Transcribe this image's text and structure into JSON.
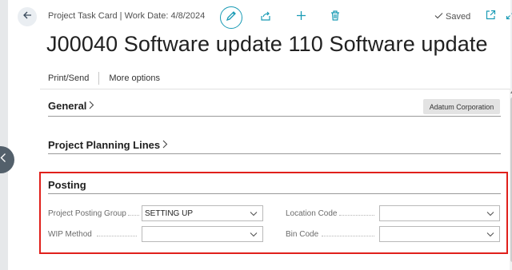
{
  "header": {
    "title": "Project Task Card | Work Date: 4/8/2024",
    "saved_label": "Saved"
  },
  "page": {
    "title": "J00040 Software update 110 Software update"
  },
  "actions": {
    "print_send": "Print/Send",
    "more_options": "More options"
  },
  "sections": {
    "general": {
      "title": "General",
      "badge": "Adatum Corporation"
    },
    "planning_lines": {
      "title": "Project Planning Lines"
    },
    "posting": {
      "title": "Posting",
      "fields": {
        "project_posting_group": {
          "label": "Project Posting Group",
          "value": "SETTING UP"
        },
        "wip_method": {
          "label": "WIP Method",
          "value": ""
        },
        "location_code": {
          "label": "Location Code",
          "value": ""
        },
        "bin_code": {
          "label": "Bin Code",
          "value": ""
        }
      }
    }
  },
  "colors": {
    "accent": "#1a9bb5",
    "highlight_border": "#e0201b",
    "collapse_button": "#53606b"
  },
  "icons": {
    "back": "arrow-left-icon",
    "collapse": "chevron-left-icon",
    "edit": "pencil-icon",
    "share": "share-icon",
    "new": "plus-icon",
    "delete": "trash-icon",
    "saved": "checkmark-icon",
    "popout": "open-in-new-window-icon",
    "expand": "expand-icon"
  }
}
